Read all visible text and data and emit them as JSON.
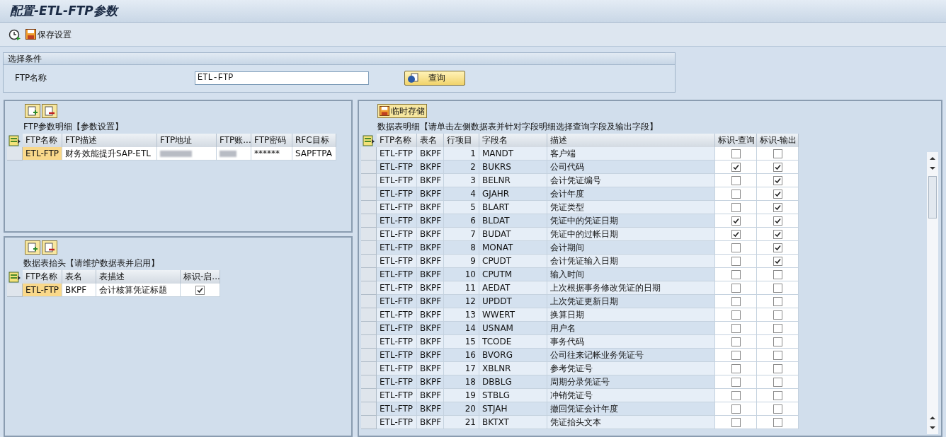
{
  "window": {
    "title": "配置-ETL-FTP参数"
  },
  "toolbar": {
    "save_label": "保存设置"
  },
  "selection": {
    "title": "选择条件",
    "field_label": "FTP名称",
    "field_value": "ETL-FTP",
    "query_button": "查询"
  },
  "params_panel": {
    "title": "FTP参数明细【参数设置】",
    "columns": [
      "FTP名称",
      "FTP描述",
      "FTP地址",
      "FTP账...",
      "FTP密码",
      "RFC目标"
    ],
    "rows": [
      {
        "cells": [
          {
            "kind": "key",
            "text": "ETL-FTP"
          },
          {
            "kind": "text",
            "text": "财务效能提升SAP-ETL"
          },
          {
            "kind": "blurred"
          },
          {
            "kind": "blurred"
          },
          {
            "kind": "text",
            "text": "******"
          },
          {
            "kind": "text",
            "text": "SAPFTPA"
          }
        ]
      }
    ]
  },
  "tables_panel": {
    "title": "数据表抬头【请维护数据表并启用】",
    "columns": [
      "FTP名称",
      "表名",
      "表描述",
      "标识-启..."
    ],
    "rows": [
      {
        "ftp": "ETL-FTP",
        "table": "BKPF",
        "desc": "会计核算凭证标题",
        "enabled": true
      }
    ]
  },
  "fields_panel": {
    "button": "临时存储",
    "title": "数据表明细【请单击左侧数据表并针对字段明细选择查询字段及输出字段】",
    "columns": [
      "FTP名称",
      "表名",
      "行项目",
      "字段名",
      "描述",
      "标识-查询",
      "标识-输出"
    ],
    "rows": [
      {
        "ftp": "ETL-FTP",
        "table": "BKPF",
        "line": "1",
        "field": "MANDT",
        "desc": "客户端",
        "query": false,
        "output": false
      },
      {
        "ftp": "ETL-FTP",
        "table": "BKPF",
        "line": "2",
        "field": "BUKRS",
        "desc": "公司代码",
        "query": true,
        "output": true
      },
      {
        "ftp": "ETL-FTP",
        "table": "BKPF",
        "line": "3",
        "field": "BELNR",
        "desc": "会计凭证编号",
        "query": false,
        "output": true
      },
      {
        "ftp": "ETL-FTP",
        "table": "BKPF",
        "line": "4",
        "field": "GJAHR",
        "desc": "会计年度",
        "query": false,
        "output": true
      },
      {
        "ftp": "ETL-FTP",
        "table": "BKPF",
        "line": "5",
        "field": "BLART",
        "desc": "凭证类型",
        "query": false,
        "output": true
      },
      {
        "ftp": "ETL-FTP",
        "table": "BKPF",
        "line": "6",
        "field": "BLDAT",
        "desc": "凭证中的凭证日期",
        "query": true,
        "output": true
      },
      {
        "ftp": "ETL-FTP",
        "table": "BKPF",
        "line": "7",
        "field": "BUDAT",
        "desc": "凭证中的过帐日期",
        "query": true,
        "output": true
      },
      {
        "ftp": "ETL-FTP",
        "table": "BKPF",
        "line": "8",
        "field": "MONAT",
        "desc": "会计期间",
        "query": false,
        "output": true
      },
      {
        "ftp": "ETL-FTP",
        "table": "BKPF",
        "line": "9",
        "field": "CPUDT",
        "desc": "会计凭证输入日期",
        "query": false,
        "output": true
      },
      {
        "ftp": "ETL-FTP",
        "table": "BKPF",
        "line": "10",
        "field": "CPUTM",
        "desc": "输入时间",
        "query": false,
        "output": false
      },
      {
        "ftp": "ETL-FTP",
        "table": "BKPF",
        "line": "11",
        "field": "AEDAT",
        "desc": "上次根据事务修改凭证的日期",
        "query": false,
        "output": false
      },
      {
        "ftp": "ETL-FTP",
        "table": "BKPF",
        "line": "12",
        "field": "UPDDT",
        "desc": "上次凭证更新日期",
        "query": false,
        "output": false
      },
      {
        "ftp": "ETL-FTP",
        "table": "BKPF",
        "line": "13",
        "field": "WWERT",
        "desc": "换算日期",
        "query": false,
        "output": false
      },
      {
        "ftp": "ETL-FTP",
        "table": "BKPF",
        "line": "14",
        "field": "USNAM",
        "desc": "用户名",
        "query": false,
        "output": false
      },
      {
        "ftp": "ETL-FTP",
        "table": "BKPF",
        "line": "15",
        "field": "TCODE",
        "desc": "事务代码",
        "query": false,
        "output": false
      },
      {
        "ftp": "ETL-FTP",
        "table": "BKPF",
        "line": "16",
        "field": "BVORG",
        "desc": "公司往来记帐业务凭证号",
        "query": false,
        "output": false
      },
      {
        "ftp": "ETL-FTP",
        "table": "BKPF",
        "line": "17",
        "field": "XBLNR",
        "desc": "参考凭证号",
        "query": false,
        "output": false
      },
      {
        "ftp": "ETL-FTP",
        "table": "BKPF",
        "line": "18",
        "field": "DBBLG",
        "desc": "周期分录凭证号",
        "query": false,
        "output": false
      },
      {
        "ftp": "ETL-FTP",
        "table": "BKPF",
        "line": "19",
        "field": "STBLG",
        "desc": "冲销凭证号",
        "query": false,
        "output": false
      },
      {
        "ftp": "ETL-FTP",
        "table": "BKPF",
        "line": "20",
        "field": "STJAH",
        "desc": "撤回凭证会计年度",
        "query": false,
        "output": false
      },
      {
        "ftp": "ETL-FTP",
        "table": "BKPF",
        "line": "21",
        "field": "BKTXT",
        "desc": "凭证抬头文本",
        "query": false,
        "output": false
      }
    ]
  }
}
